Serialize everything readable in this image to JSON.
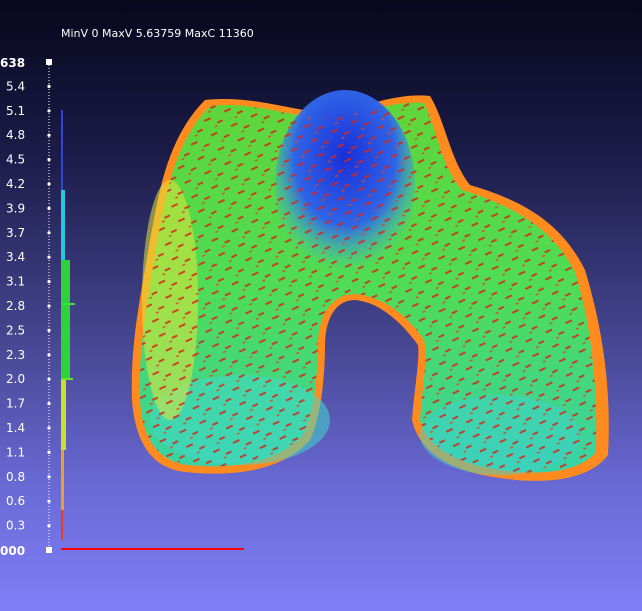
{
  "viewer": {
    "stats_text": "MinV 0 MaxV 5.63759 MaxC 11360"
  },
  "colorbar": {
    "max_label": "638",
    "min_label": "000",
    "ticks": [
      "5.4",
      "5.1",
      "4.8",
      "4.5",
      "4.2",
      "3.9",
      "3.7",
      "3.4",
      "3.1",
      "2.8",
      "2.5",
      "2.3",
      "2.0",
      "1.7",
      "1.4",
      "1.1",
      "0.8",
      "0.6",
      "0.3"
    ]
  },
  "colors": {
    "histogram_baseline": "#ff0000",
    "scale_dots": "#ffffff"
  }
}
